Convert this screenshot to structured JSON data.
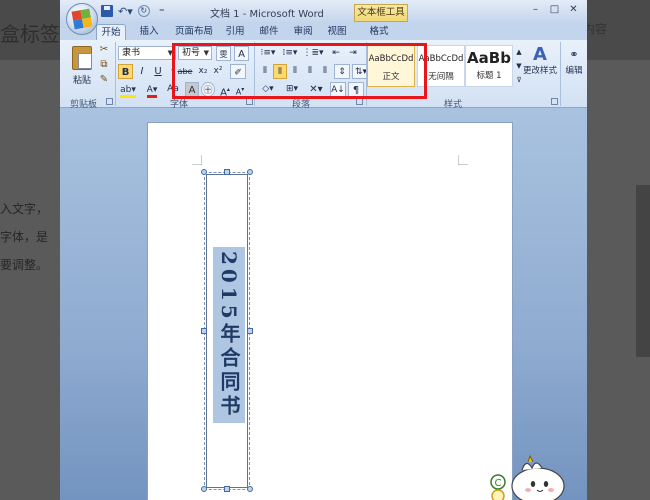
{
  "background": {
    "title": "盒标签",
    "search_hint": "内容",
    "lines": [
      "入文字，",
      "字体，是",
      "要调整。"
    ]
  },
  "titlebar": {
    "window_title": "文档 1 - Microsoft Word",
    "contextual_tab_header": "文本框工具",
    "qat": [
      "save-icon",
      "undo-icon",
      "redo-icon",
      "customize-icon"
    ]
  },
  "tabs": [
    {
      "label": "开始",
      "active": true
    },
    {
      "label": "插入",
      "active": false
    },
    {
      "label": "页面布局",
      "active": false
    },
    {
      "label": "引用",
      "active": false
    },
    {
      "label": "邮件",
      "active": false
    },
    {
      "label": "审阅",
      "active": false
    },
    {
      "label": "视图",
      "active": false
    },
    {
      "label": "格式",
      "active": false
    }
  ],
  "ribbon": {
    "clipboard": {
      "group_label": "剪贴板",
      "paste_label": "粘贴"
    },
    "font": {
      "group_label": "字体",
      "font_name": "隶书",
      "font_size": "初号",
      "bold": "B",
      "italic": "I",
      "underline": "U",
      "strike": "abe",
      "subscript": "x₂",
      "superscript": "x²",
      "change_case": "Aa",
      "grow": "A",
      "shrink": "A"
    },
    "paragraph": {
      "group_label": "段落"
    },
    "styles": {
      "group_label": "样式",
      "cards": [
        {
          "sample": "AaBbCcDd",
          "name": "正文",
          "selected": true
        },
        {
          "sample": "AaBbCcDd",
          "name": "无间隔",
          "selected": false
        },
        {
          "sample": "AaBb",
          "name": "标题 1",
          "selected": false
        }
      ],
      "change_styles_label": "更改样式"
    },
    "editing": {
      "label": "编辑"
    }
  },
  "document": {
    "textbox_text": "2015年合同书"
  },
  "colors": {
    "highlight_box": "#e8151b",
    "font_color_bar": "#e0201f",
    "highlight_color_bar": "#ffe600",
    "text_blue": "#1f3a66"
  }
}
